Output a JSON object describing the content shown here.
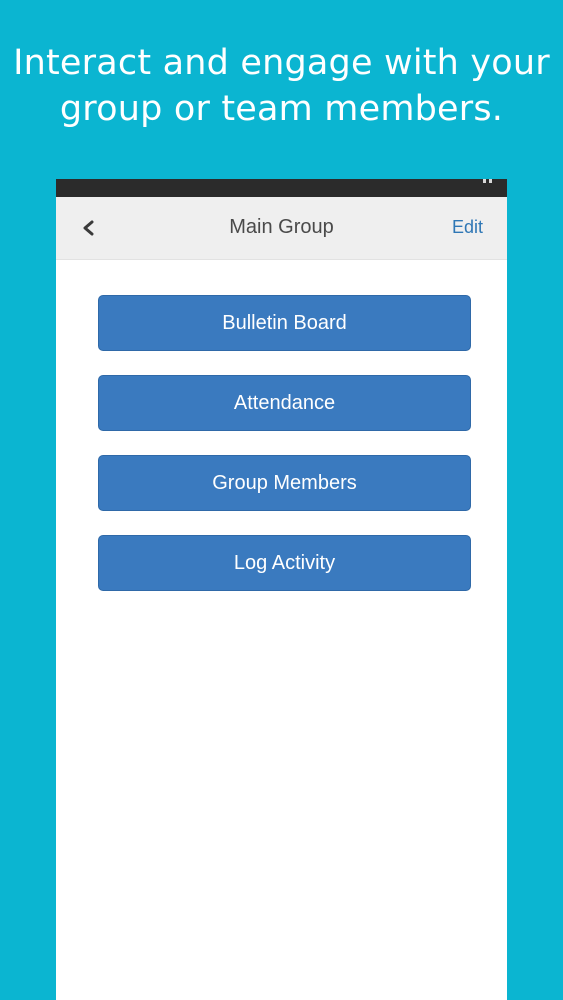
{
  "promo": {
    "line1": "Interact and engage with your",
    "line2": "group or team members."
  },
  "header": {
    "back_icon": "chevron-left-icon",
    "title": "Main Group",
    "edit_label": "Edit"
  },
  "menu": {
    "items": [
      {
        "label": "Bulletin Board"
      },
      {
        "label": "Attendance"
      },
      {
        "label": "Group Members"
      },
      {
        "label": "Log Activity"
      }
    ]
  },
  "colors": {
    "background": "#0bb5d1",
    "button": "#3a7abf",
    "link": "#2f77b5",
    "status_bar": "#2b2b2b"
  }
}
